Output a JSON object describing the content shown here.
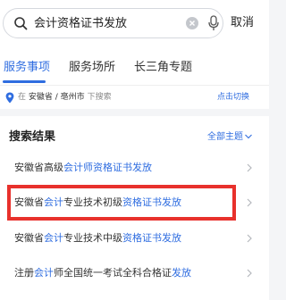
{
  "search": {
    "query": "会计资格证书发放",
    "cancel_label": "取消"
  },
  "tabs": [
    {
      "label": "服务事项",
      "active": true
    },
    {
      "label": "服务场所",
      "active": false
    },
    {
      "label": "长三角专题",
      "active": false
    }
  ],
  "location": {
    "prefix": "在",
    "province": "安徽省",
    "separator": " / ",
    "city": "亳州市",
    "suffix": "下搜索",
    "switch_label": "点击切换"
  },
  "results": {
    "title": "搜索结果",
    "filter_label": "全部主题",
    "items": [
      {
        "parts": [
          {
            "t": "安徽省高级",
            "hl": false
          },
          {
            "t": "会计师资格证书发放",
            "hl": true
          }
        ]
      },
      {
        "parts": [
          {
            "t": "安徽省",
            "hl": false
          },
          {
            "t": "会计",
            "hl": true
          },
          {
            "t": "专业技术初级",
            "hl": false
          },
          {
            "t": "资格证书发放",
            "hl": true
          }
        ]
      },
      {
        "parts": [
          {
            "t": "安徽省",
            "hl": false
          },
          {
            "t": "会计",
            "hl": true
          },
          {
            "t": "专业技术中级",
            "hl": false
          },
          {
            "t": "资格证书发放",
            "hl": true
          }
        ]
      },
      {
        "parts": [
          {
            "t": "注册",
            "hl": false
          },
          {
            "t": "会计",
            "hl": true
          },
          {
            "t": "师全国统一考试全科合格证",
            "hl": false
          },
          {
            "t": "发放",
            "hl": true
          }
        ]
      }
    ]
  },
  "colors": {
    "accent": "#2f6de0",
    "highlight_border": "#e8312c"
  }
}
